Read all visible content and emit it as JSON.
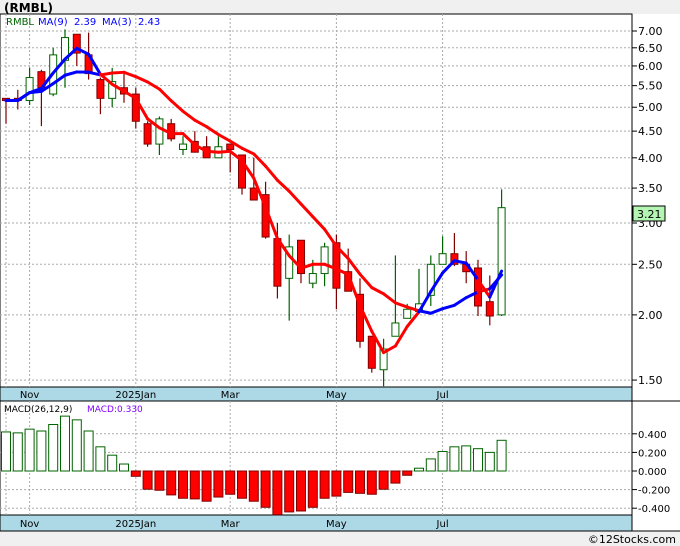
{
  "header": {
    "title": "(RMBL)"
  },
  "legend": {
    "symbol": "RMBL",
    "ma9_label": "MA(9)",
    "ma9_value": "2.39",
    "ma3_label": "MA(3)",
    "ma3_value": "2.43"
  },
  "macd_legend": {
    "label": "MACD(26,12,9)",
    "value_label": "MACD:0.330"
  },
  "last_price": "3.21",
  "footer": {
    "copyright": "©12Stocks.com"
  },
  "colors": {
    "up": "#006400",
    "down": "#ff0000",
    "ma_up": "#0000ff",
    "ma_down": "#ff0000",
    "axis_band": "#add8e6",
    "last_price_bg": "#b4f5b4"
  },
  "chart_data": [
    {
      "type": "candlestick",
      "title": "(RMBL)",
      "y_scale": "log",
      "ylim": [
        1.42,
        7.3
      ],
      "y_ticks": [
        "7.00",
        "6.50",
        "6.00",
        "5.50",
        "5.00",
        "4.50",
        "4.00",
        "3.50",
        "3.00",
        "2.50",
        "2.00",
        "1.50"
      ],
      "x_ticks": [
        {
          "label": "Nov",
          "index": 2
        },
        {
          "label": "2025Jan",
          "index": 11
        },
        {
          "label": "Mar",
          "index": 19
        },
        {
          "label": "May",
          "index": 28
        },
        {
          "label": "Jul",
          "index": 37
        }
      ],
      "grid": true,
      "moving_averages": [
        {
          "name": "MA(9)",
          "period": 9,
          "last": 2.39
        },
        {
          "name": "MA(3)",
          "period": 3,
          "last": 2.43
        }
      ],
      "ohlc": [
        [
          5.2,
          5.2,
          4.65,
          5.15
        ],
        [
          5.2,
          5.4,
          4.95,
          5.15
        ],
        [
          5.15,
          5.95,
          5.05,
          5.7
        ],
        [
          5.85,
          5.9,
          4.6,
          5.45
        ],
        [
          5.3,
          6.5,
          5.25,
          6.3
        ],
        [
          6.15,
          7.05,
          5.45,
          6.8
        ],
        [
          6.9,
          6.9,
          6.0,
          6.35
        ],
        [
          6.3,
          6.95,
          5.65,
          5.8
        ],
        [
          5.65,
          5.7,
          4.85,
          5.2
        ],
        [
          5.2,
          5.95,
          5.0,
          5.6
        ],
        [
          5.45,
          5.8,
          5.1,
          5.3
        ],
        [
          5.3,
          5.45,
          4.55,
          4.7
        ],
        [
          4.65,
          4.7,
          4.2,
          4.25
        ],
        [
          4.25,
          4.8,
          4.05,
          4.75
        ],
        [
          4.65,
          4.75,
          4.3,
          4.35
        ],
        [
          4.15,
          4.4,
          4.05,
          4.25
        ],
        [
          4.3,
          4.5,
          4.1,
          4.1
        ],
        [
          4.2,
          4.4,
          4.0,
          4.0
        ],
        [
          4.0,
          4.4,
          4.0,
          4.2
        ],
        [
          4.25,
          4.25,
          3.75,
          4.15
        ],
        [
          4.05,
          4.05,
          3.4,
          3.5
        ],
        [
          3.5,
          4.0,
          3.32,
          3.32
        ],
        [
          3.4,
          3.6,
          2.8,
          2.82
        ],
        [
          2.8,
          3.0,
          2.15,
          2.27
        ],
        [
          2.35,
          2.85,
          1.95,
          2.7
        ],
        [
          2.78,
          2.78,
          2.3,
          2.4
        ],
        [
          2.3,
          2.55,
          2.25,
          2.4
        ],
        [
          2.4,
          2.75,
          2.27,
          2.7
        ],
        [
          2.75,
          2.85,
          2.05,
          2.25
        ],
        [
          2.42,
          2.68,
          2.22,
          2.22
        ],
        [
          2.19,
          2.35,
          1.73,
          1.78
        ],
        [
          1.82,
          1.82,
          1.55,
          1.58
        ],
        [
          1.57,
          1.8,
          1.46,
          1.72
        ],
        [
          1.82,
          2.6,
          1.82,
          1.93
        ],
        [
          1.97,
          2.1,
          1.97,
          2.05
        ],
        [
          2.03,
          2.45,
          2.03,
          2.1
        ],
        [
          2.18,
          2.6,
          2.08,
          2.5
        ],
        [
          2.5,
          2.83,
          2.5,
          2.62
        ],
        [
          2.62,
          2.87,
          2.48,
          2.5
        ],
        [
          2.5,
          2.65,
          2.3,
          2.42
        ],
        [
          2.46,
          2.55,
          1.99,
          2.08
        ],
        [
          2.12,
          2.38,
          1.91,
          1.99
        ],
        [
          2.0,
          3.48,
          1.99,
          3.21
        ]
      ]
    },
    {
      "type": "bar",
      "title": "MACD(26,12,9)",
      "ylim": [
        -0.5,
        0.65
      ],
      "y_ticks": [
        "0.400",
        "0.200",
        "0.000",
        "-0.200",
        "-0.400"
      ],
      "x_ticks": [
        {
          "label": "Nov",
          "index": 2
        },
        {
          "label": "2025Jan",
          "index": 11
        },
        {
          "label": "Mar",
          "index": 19
        },
        {
          "label": "May",
          "index": 28
        },
        {
          "label": "Jul",
          "index": 37
        }
      ],
      "values": [
        0.42,
        0.41,
        0.45,
        0.43,
        0.5,
        0.59,
        0.55,
        0.43,
        0.26,
        0.17,
        0.075,
        -0.057,
        -0.196,
        -0.207,
        -0.257,
        -0.293,
        -0.3,
        -0.325,
        -0.28,
        -0.25,
        -0.293,
        -0.325,
        -0.39,
        -0.47,
        -0.44,
        -0.43,
        -0.39,
        -0.293,
        -0.27,
        -0.23,
        -0.24,
        -0.25,
        -0.196,
        -0.13,
        -0.046,
        0.03,
        0.13,
        0.21,
        0.26,
        0.27,
        0.24,
        0.2,
        0.33
      ]
    }
  ]
}
